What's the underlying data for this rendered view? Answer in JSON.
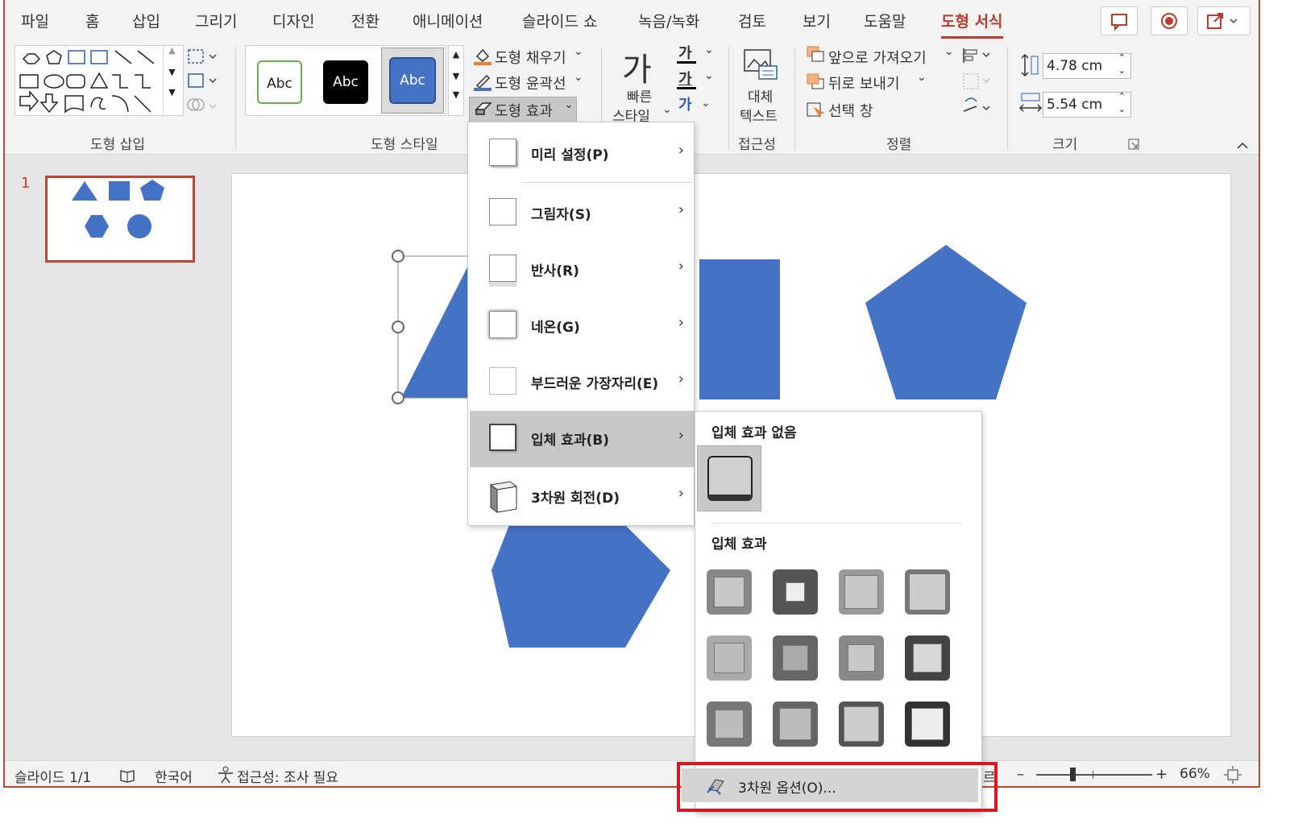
{
  "tabs": [
    "파일",
    "홈",
    "삽입",
    "그리기",
    "디자인",
    "전환",
    "애니메이션",
    "슬라이드 쇼",
    "녹음/녹화",
    "검토",
    "보기",
    "도움말",
    "도형 서식"
  ],
  "ribbon": {
    "groups": {
      "insert_shapes": "도형 삽입",
      "shape_styles": "도형 스타일",
      "accessibility": "접근성",
      "arrange": "정렬",
      "size": "크기"
    },
    "style_gallery": [
      "Abc",
      "Abc",
      "Abc"
    ],
    "fill": "도형 채우기",
    "outline": "도형 윤곽선",
    "effects": "도형 효과",
    "quick_styles_line1": "빠른",
    "quick_styles_line2": "스타일",
    "alt_text_line1": "대체",
    "alt_text_line2": "텍스트",
    "bring_forward": "앞으로 가져오기",
    "send_backward": "뒤로 보내기",
    "selection_pane": "선택 창",
    "height": "4.78 cm",
    "width": "5.54 cm",
    "ga_glyph": "가"
  },
  "thumbnail": {
    "number": "1"
  },
  "effects_menu": [
    {
      "label": "미리 설정(P)"
    },
    {
      "label": "그림자(S)"
    },
    {
      "label": "반사(R)"
    },
    {
      "label": "네온(G)"
    },
    {
      "label": "부드러운 가장자리(E)"
    },
    {
      "label": "입체 효과(B)"
    },
    {
      "label": "3차원 회전(D)"
    }
  ],
  "bevel_submenu": {
    "no_bevel_header": "입체 효과 없음",
    "bevel_header": "입체 효과",
    "options_label": "3차원 옵션(O)..."
  },
  "status": {
    "slide": "슬라이드 1/1",
    "language": "한국어",
    "accessibility": "접근성: 조사 필요",
    "notes_partial": "르",
    "zoom": "66%"
  },
  "colors": {
    "accent": "#c0392b",
    "shape": "#4472c4",
    "highlight_box": "#e0141e"
  }
}
